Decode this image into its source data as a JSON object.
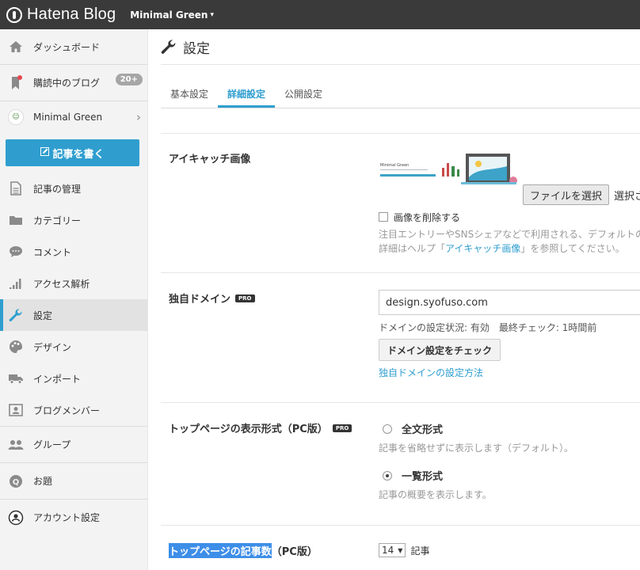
{
  "topbar": {
    "logo_text": "Hatena Blog",
    "blog_name": "Minimal Green"
  },
  "sidebar": {
    "dashboard": "ダッシュボード",
    "reading": "購読中のブログ",
    "reading_badge": "20+",
    "blog_name": "Minimal Green",
    "write": "記事を書く",
    "manage": "記事の管理",
    "category": "カテゴリー",
    "comment": "コメント",
    "access": "アクセス解析",
    "settings": "設定",
    "design": "デザイン",
    "import": "インポート",
    "members": "ブログメンバー",
    "group": "グループ",
    "odai": "お題",
    "account": "アカウント設定"
  },
  "main": {
    "title": "設定",
    "tabs": [
      "基本設定",
      "詳細設定",
      "公開設定"
    ],
    "active_tab": "詳細設定"
  },
  "eyecatch": {
    "label": "アイキャッチ画像",
    "thumb_title": "Minimal Green",
    "file_button": "ファイルを選択",
    "file_status": "選択さ",
    "delete_label": "画像を削除する",
    "help1": "注目エントリーやSNSシェアなどで利用される、デフォルトの",
    "help2_pre": "詳細はヘルプ「",
    "help2_link": "アイキャッチ画像",
    "help2_post": "」を参照してください。"
  },
  "domain": {
    "label": "独自ドメイン",
    "pro": "PRO",
    "value": "design.syofuso.com",
    "status": "ドメインの設定状況: 有効　最終チェック: 1時間前",
    "check_button": "ドメイン設定をチェック",
    "howto_link": "独自ドメインの設定方法"
  },
  "display": {
    "label": "トップページの表示形式（PC版）",
    "pro": "PRO",
    "option_full": "全文形式",
    "option_full_help": "記事を省略せずに表示します（デフォルト）。",
    "option_list": "一覧形式",
    "option_list_help": "記事の概要を表示します。",
    "selected": "一覧形式"
  },
  "count": {
    "label_highlighted": "トップページの記事数",
    "label_rest": "（PC版）",
    "value": "14",
    "unit": "記事"
  },
  "colors": {
    "accent": "#2f9ecf",
    "topbar": "#3a3a3a",
    "selection": "#3d8ee8"
  }
}
